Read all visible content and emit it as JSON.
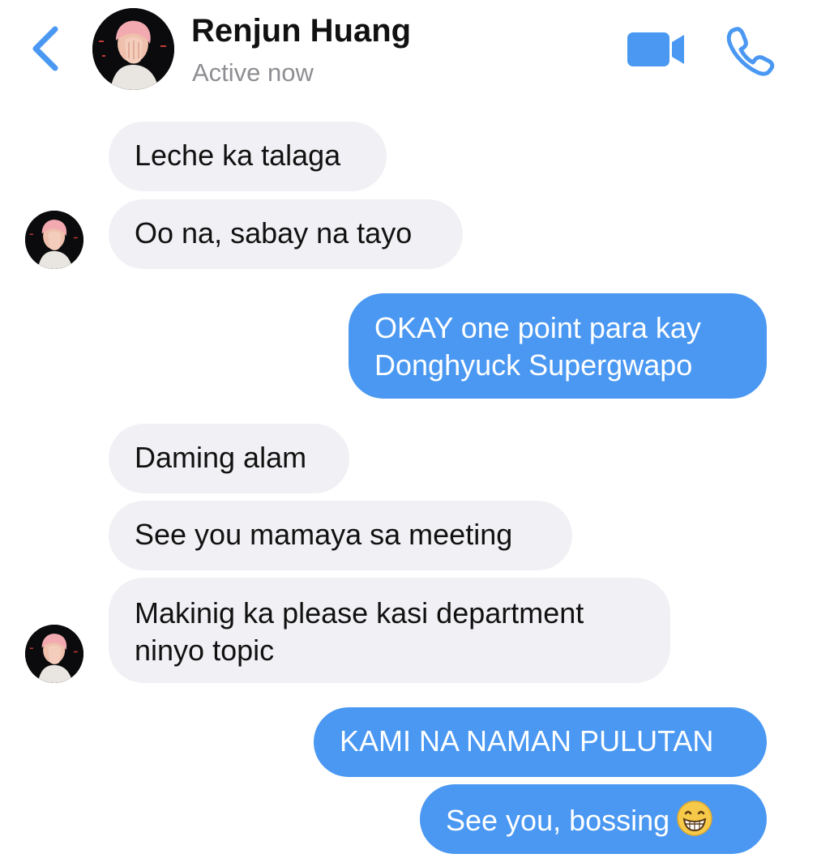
{
  "header": {
    "contact_name": "Renjun Huang",
    "status": "Active now",
    "accent_color": "#4a98f2",
    "icons": [
      "chevron-left-icon",
      "video-camera-icon",
      "phone-icon"
    ]
  },
  "messages": [
    {
      "direction": "incoming",
      "text": "Leche ka talaga"
    },
    {
      "direction": "incoming",
      "text": "Oo na, sabay na tayo"
    },
    {
      "direction": "outgoing",
      "lines": [
        "OKAY one point para kay",
        "Donghyuck Supergwapo"
      ]
    },
    {
      "direction": "incoming",
      "text": "Daming alam"
    },
    {
      "direction": "incoming",
      "text": "See you mamaya sa meeting"
    },
    {
      "direction": "incoming",
      "lines": [
        "Makinig ka please kasi department",
        "ninyo topic"
      ]
    },
    {
      "direction": "outgoing",
      "text": "KAMI NA NAMAN PULUTAN"
    },
    {
      "direction": "outgoing",
      "text": "See you, bossing",
      "emoji": "grinning-face-icon"
    }
  ],
  "colors": {
    "incoming_bubble": "#f1f1f5",
    "outgoing_bubble": "#4a98f2",
    "status_text": "#8e8e93"
  }
}
